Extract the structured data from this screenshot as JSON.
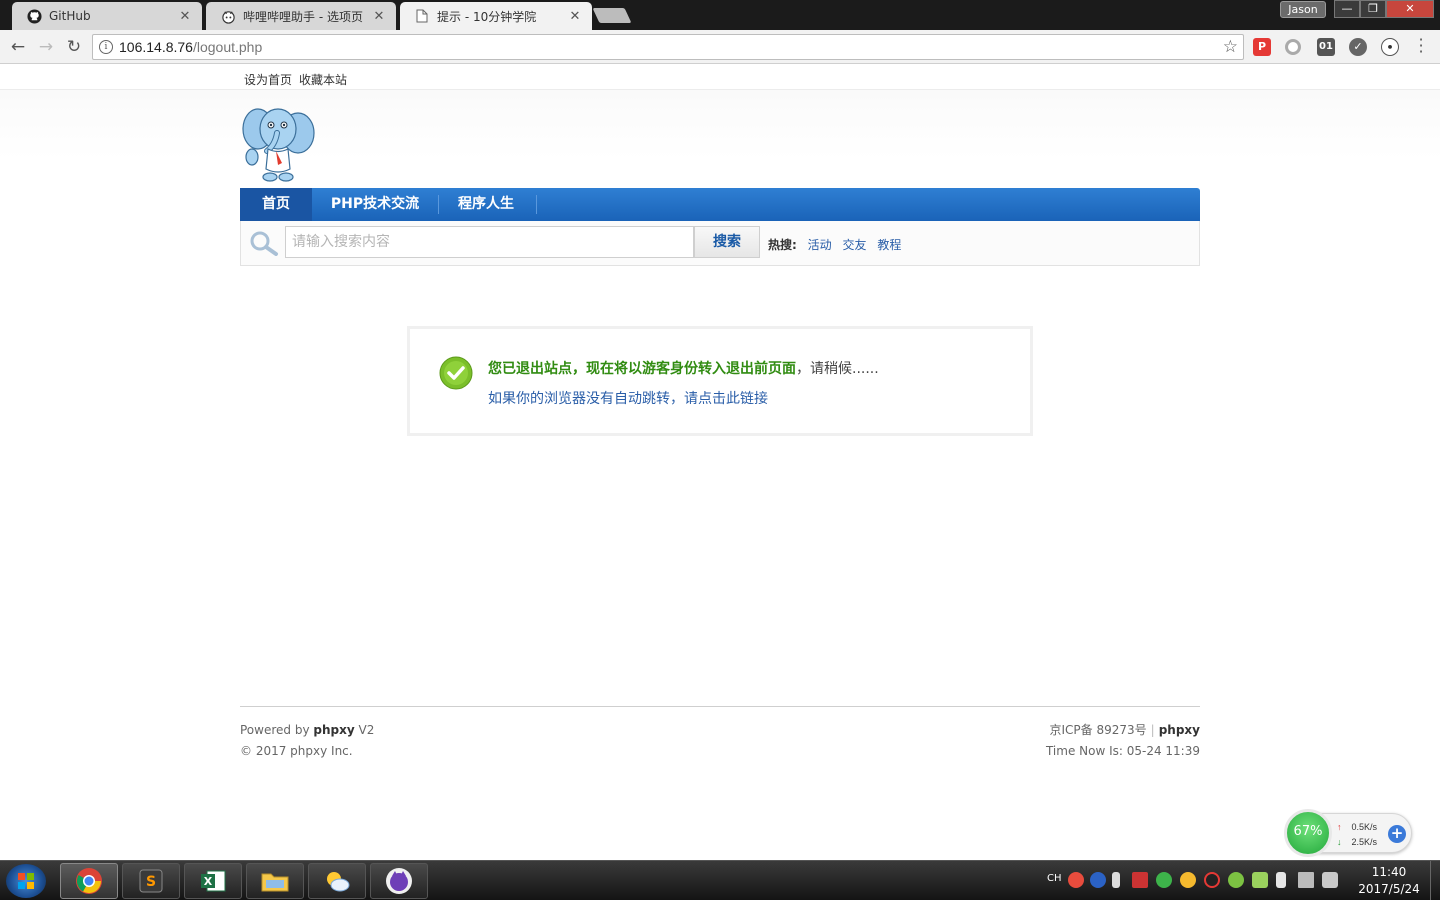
{
  "browser": {
    "tabs": [
      {
        "title": "GitHub",
        "icon": "github-icon",
        "active": false
      },
      {
        "title": "哔哩哔哩助手 - 选项页",
        "icon": "bilibili-icon",
        "active": false
      },
      {
        "title": "提示 - 10分钟学院",
        "icon": "page-icon",
        "active": true
      }
    ],
    "user": "Jason",
    "url_host": "106.14.8.76",
    "url_path": "/logout.php"
  },
  "site": {
    "topbar": {
      "set_home": "设为首页",
      "bookmark": "收藏本站"
    },
    "nav": [
      "首页",
      "PHP技术交流",
      "程序人生"
    ],
    "search": {
      "placeholder": "请输入搜索内容",
      "button": "搜索",
      "hot_label": "热搜:",
      "hot_links": [
        "活动",
        "交友",
        "教程"
      ]
    },
    "message": {
      "strong": "您已退出站点，现在将以游客身份转入退出前页面",
      "rest": "，请稍候......",
      "link": "如果你的浏览器没有自动跳转，请点击此链接"
    },
    "footer": {
      "powered_prefix": "Powered by",
      "powered_brand": "phpxy",
      "powered_version": "V2",
      "copyright": "© 2017 phpxy Inc.",
      "icp": "京ICP备 89273号",
      "brand": "phpxy",
      "time_now": "Time Now Is: 05-24 11:39"
    }
  },
  "net_widget": {
    "percent": "67%",
    "up": "0.5K/s",
    "down": "2.5K/s"
  },
  "taskbar": {
    "lang": "CH",
    "time": "11:40",
    "date": "2017/5/24"
  }
}
